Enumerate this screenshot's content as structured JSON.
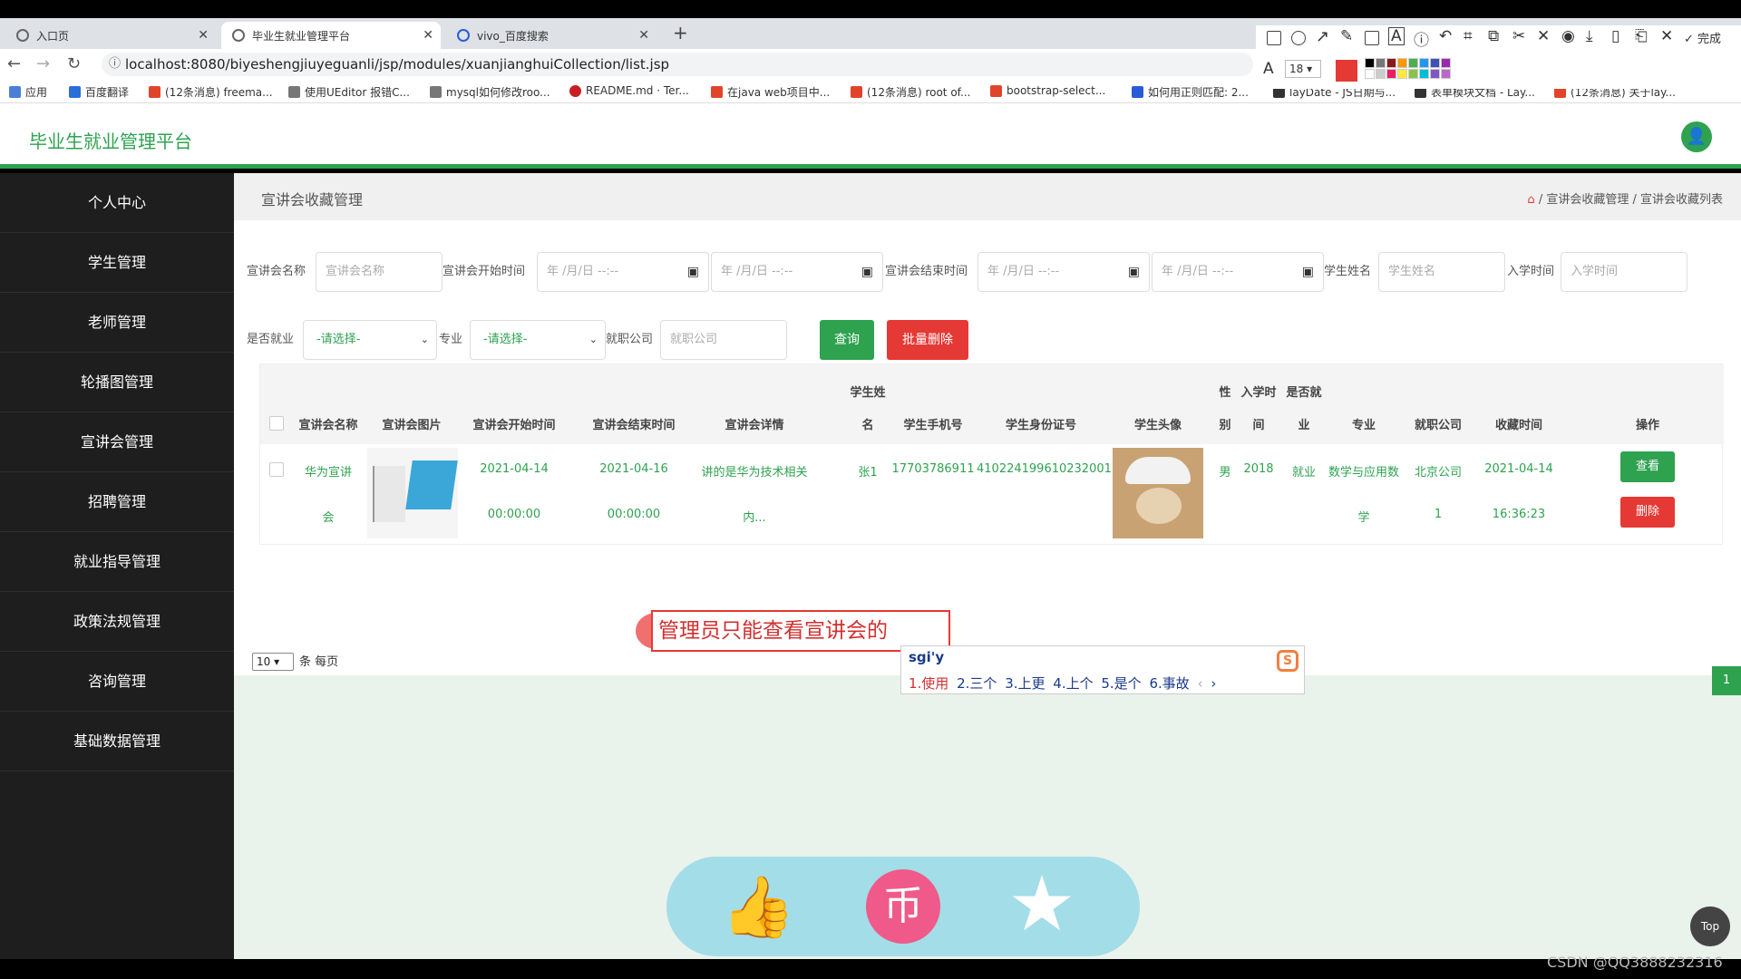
{
  "browser": {
    "tabs": [
      {
        "label": "入口页"
      },
      {
        "label": "毕业生就业管理平台"
      },
      {
        "label": "vivo_百度搜索"
      }
    ],
    "url": "localhost:8080/biyeshengjiuyeguanli/jsp/modules/xuanjianghuiCollection/list.jsp",
    "bookmarks": [
      "应用",
      "百度翻译",
      "(12条消息) freema...",
      "使用UEditor 报错C...",
      "mysql如何修改roo...",
      "README.md · Ter...",
      "在java web项目中...",
      "(12条消息) root of...",
      "bootstrap-select...",
      "如何用正则匹配: 2...",
      "layDate - JS日期与...",
      "表单模块文档 - Lay...",
      "(12条消息) 关于lay..."
    ],
    "annot_font_size": "18",
    "annot_done": "完成",
    "colors": [
      "#e53935",
      "#000000",
      "#777777",
      "#8b1a1a",
      "#ff9800",
      "#4caf50",
      "#2196f3",
      "#3f51b5",
      "#9c27b0",
      "#ffffff",
      "#cccccc",
      "#e91e63",
      "#ffeb3b",
      "#8bc34a",
      "#00bcd4",
      "#7e57c2",
      "#ba68c8"
    ]
  },
  "app": {
    "title": "毕业生就业管理平台",
    "accent": "#2ea24f",
    "sidebar": [
      "个人中心",
      "学生管理",
      "老师管理",
      "轮播图管理",
      "宣讲会管理",
      "招聘管理",
      "就业指导管理",
      "政策法规管理",
      "咨询管理",
      "基础数据管理"
    ],
    "breadcrumb_title": "宣讲会收藏管理",
    "breadcrumbs": "/ 宣讲会收藏管理 / 宣讲会收藏列表"
  },
  "filters": {
    "name_label": "宣讲会名称",
    "name_placeholder": "宣讲会名称",
    "start_label": "宣讲会开始时间",
    "date_placeholder": "年 /月/日 --:--",
    "end_label": "宣讲会结束时间",
    "student_label": "学生姓名",
    "student_placeholder": "学生姓名",
    "enroll_label": "入学时间",
    "enroll_placeholder": "入学时间",
    "employed_label": "是否就业",
    "major_label": "专业",
    "select_placeholder": "-请选择-",
    "company_label": "就职公司",
    "company_placeholder": "就职公司",
    "query_button": "查询",
    "batch_delete_button": "批量删除"
  },
  "table": {
    "header_top": {
      "name": "学生姓",
      "gender": "性",
      "enroll": "入学时",
      "employed": "是否就"
    },
    "headers": [
      "宣讲会名称",
      "宣讲会图片",
      "宣讲会开始时间",
      "宣讲会结束时间",
      "宣讲会详情",
      "名",
      "学生手机号",
      "学生身份证号",
      "学生头像",
      "别",
      "间",
      "业",
      "专业",
      "就职公司",
      "收藏时间",
      "操作"
    ],
    "rows": [
      {
        "name_line1": "华为宣讲",
        "name_line2": "会",
        "start_line1": "2021-04-14",
        "start_line2": "00:00:00",
        "end_line1": "2021-04-16",
        "end_line2": "00:00:00",
        "detail_line1": "讲的是华为技术相关",
        "detail_line2": "内...",
        "student": "张1",
        "phone": "17703786911",
        "idcard": "410224199610232001",
        "gender": "男",
        "enroll": "2018",
        "employed": "就业",
        "major_line1": "数学与应用数",
        "major_line2": "学",
        "company_line1": "北京公司",
        "company_line2": "1",
        "collect_line1": "2021-04-14",
        "collect_line2": "16:36:23",
        "view_button": "查看",
        "delete_button": "删除"
      }
    ]
  },
  "pager": {
    "per_page_value": "10",
    "per_page_suffix": "条 每页",
    "current_page": "1"
  },
  "overlay": {
    "annotation_text": "管理员只能查看宣讲会的",
    "ime_input": "sgi'y",
    "ime_candidates": [
      "1.使用",
      "2.三个",
      "3.上更",
      "4.上个",
      "5.是个",
      "6.事故"
    ],
    "ime_logo": "S",
    "top_button": "Top",
    "watermark": "CSDN @QQ3888232316"
  }
}
